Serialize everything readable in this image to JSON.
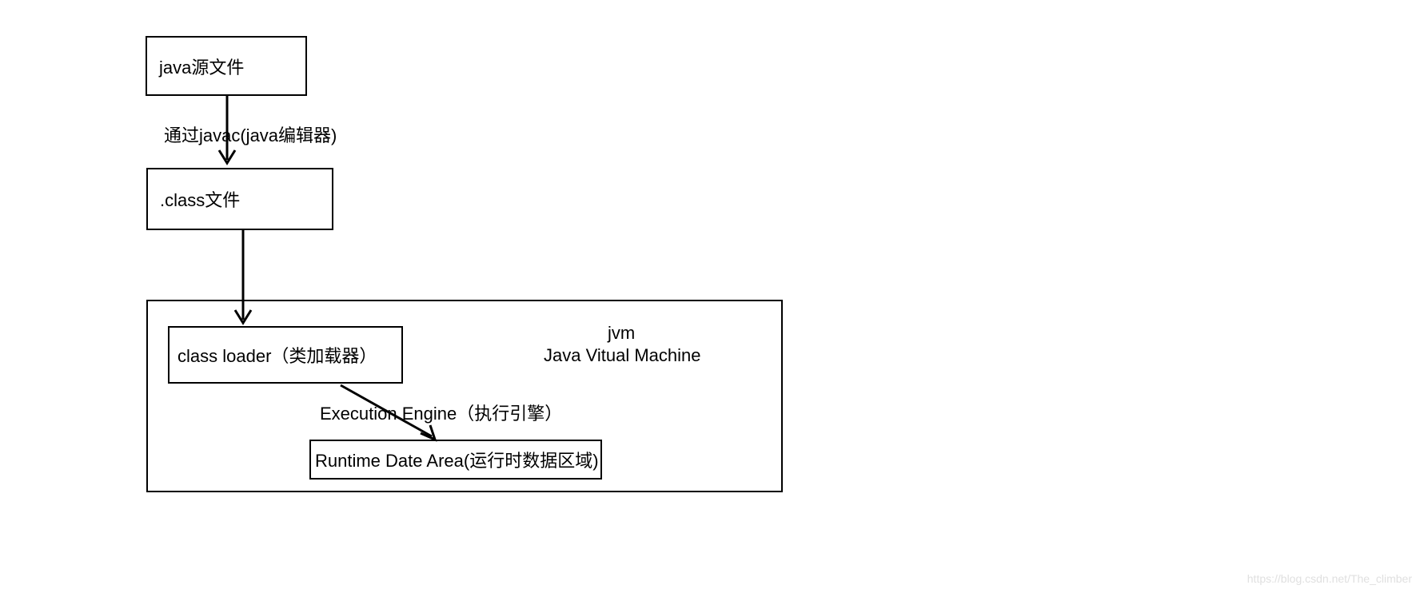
{
  "nodes": {
    "source_file": "java源文件",
    "class_file": ".class文件",
    "class_loader": "class loader（类加载器）",
    "runtime_area": "Runtime Date Area(运行时数据区域)"
  },
  "labels": {
    "compiler": "通过javac(java编辑器)",
    "jvm_line1": "jvm",
    "jvm_line2": "Java Vitual Machine",
    "execution_engine": "Execution Engine（执行引擎）"
  },
  "watermark": "https://blog.csdn.net/The_climber"
}
